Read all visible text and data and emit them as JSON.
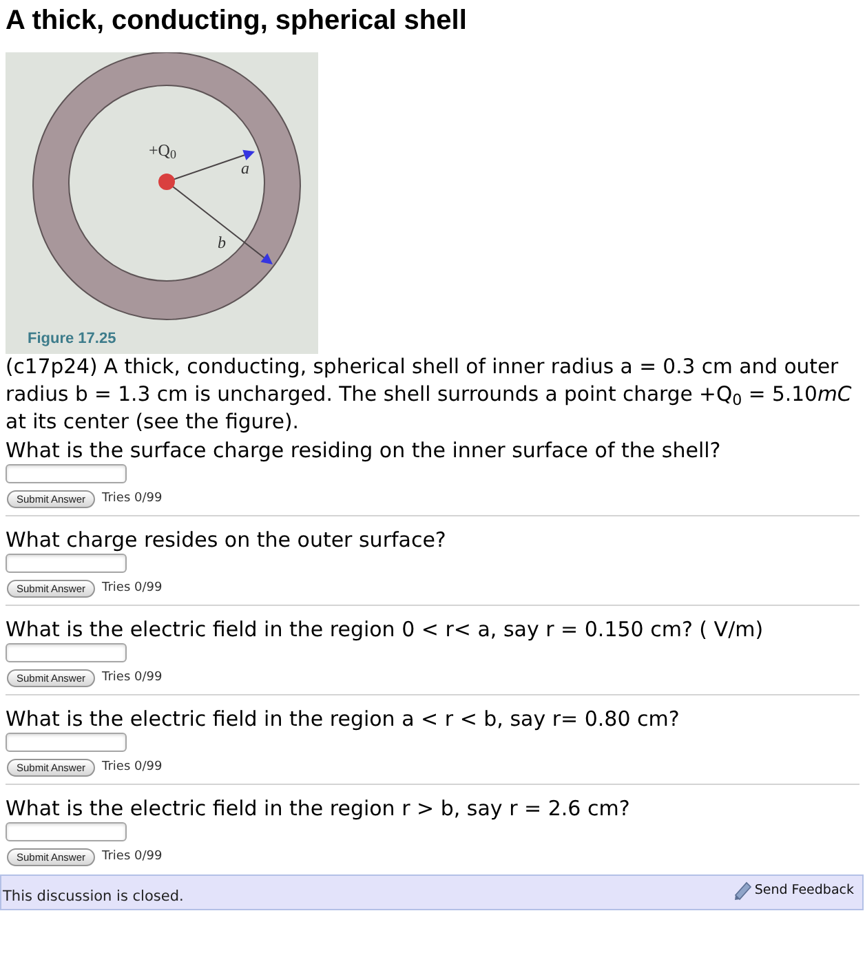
{
  "title": "A thick, conducting, spherical shell",
  "figure": {
    "charge_label": "+Q$_{0}$",
    "arrows": [
      {
        "label": "a"
      },
      {
        "label": "b"
      }
    ],
    "caption": "Figure 17.25"
  },
  "intro": [
    {
      "text": "(c17p24) A thick, conducting, spherical shell of inner radius a = 0.3 cm and outer radius b = 1.3 cm is uncharged. The shell surrounds a point charge +Q$_{0}$ = 5.10",
      "italic": false
    },
    {
      "text": "mC",
      "italic": true
    },
    {
      "text": " at its center (see the figure).",
      "italic": false
    }
  ],
  "questions": [
    {
      "text": "What is the surface charge residing on the inner surface of the shell?",
      "button": "Submit Answer",
      "tries": "Tries 0/99"
    },
    {
      "text": "What charge resides on the outer surface?",
      "button": "Submit Answer",
      "tries": "Tries 0/99"
    },
    {
      "text": "What is the electric field in the region 0 < r< a, say r = 0.150 cm? ( V/m)",
      "button": "Submit Answer",
      "tries": "Tries 0/99"
    },
    {
      "text": "What is the electric field in the region a < r < b, say r= 0.80 cm?",
      "button": "Submit Answer",
      "tries": "Tries 0/99"
    },
    {
      "text": "What is the electric field in the region r > b, say r = 2.6 cm?",
      "button": "Submit Answer",
      "tries": "Tries 0/99"
    }
  ],
  "footer": {
    "message": "This discussion is closed.",
    "link": "Send Feedback"
  }
}
